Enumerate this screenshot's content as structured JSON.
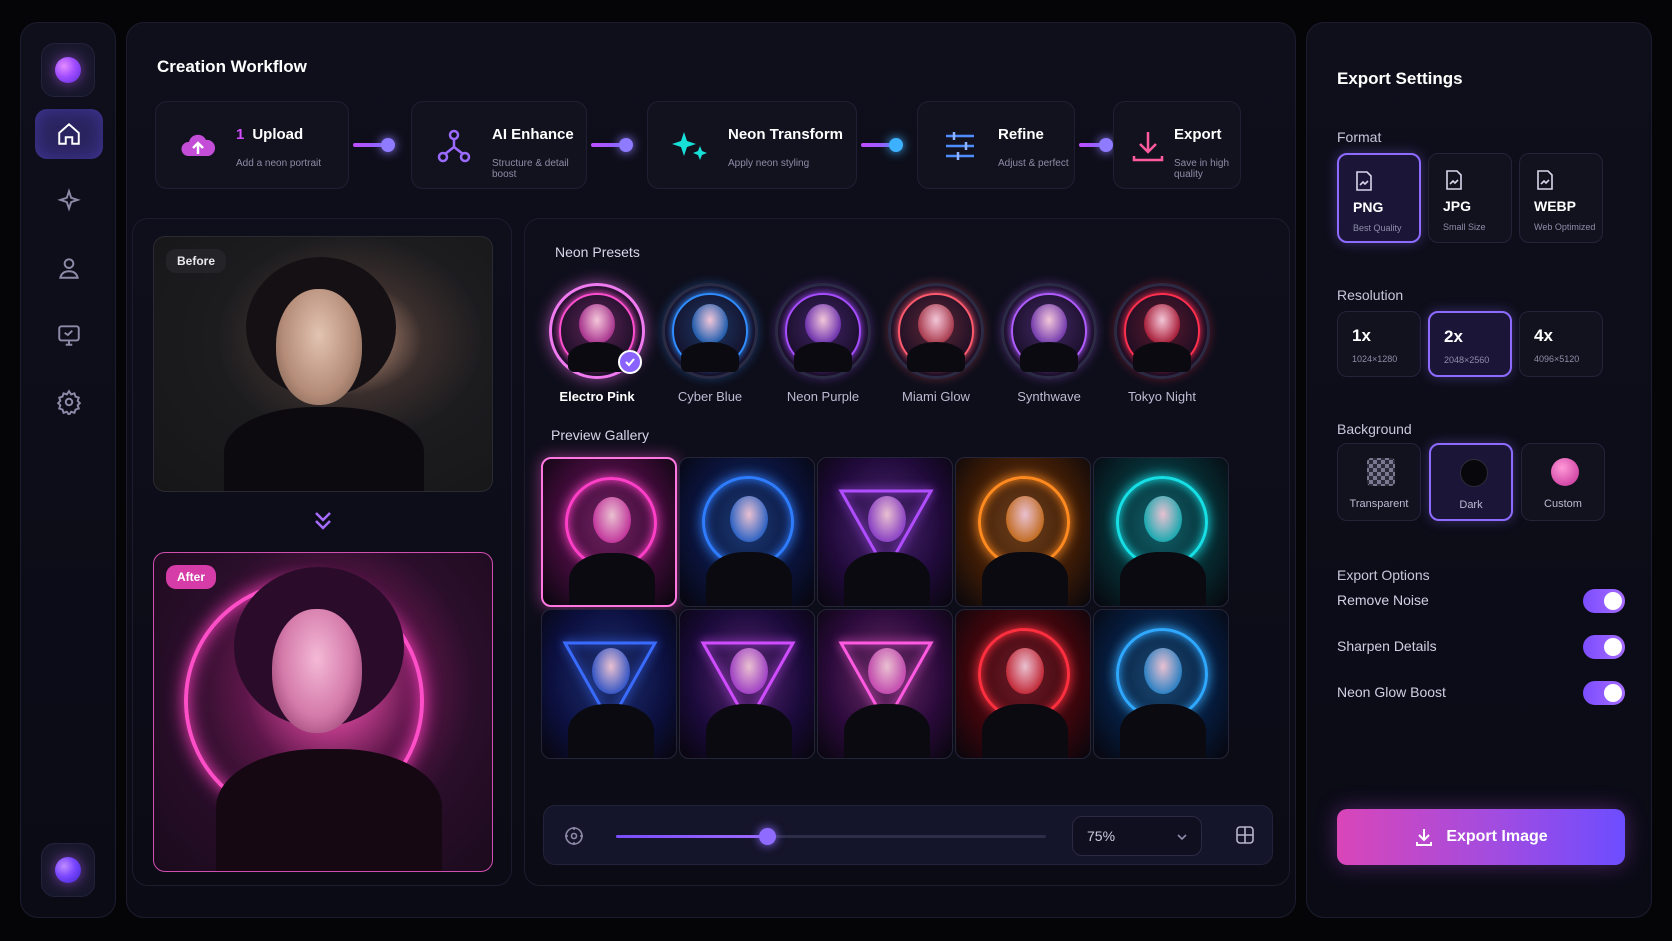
{
  "workflow": {
    "title": "Creation Workflow",
    "steps": [
      {
        "num": "1",
        "title": "Upload",
        "sub": "Add a neon portrait",
        "icon": "cloud-upload-icon"
      },
      {
        "num": "",
        "title": "AI Enhance",
        "sub": "Structure & detail boost",
        "icon": "nodes-icon"
      },
      {
        "num": "",
        "title": "Neon Transform",
        "sub": "Apply neon styling",
        "icon": "sparkles-icon"
      },
      {
        "num": "",
        "title": "Refine",
        "sub": "Adjust & perfect",
        "icon": "sliders-icon"
      },
      {
        "num": "",
        "title": "Export",
        "sub": "Save in high quality",
        "icon": "download-icon"
      }
    ]
  },
  "sidebar": {
    "items": [
      {
        "name": "home",
        "icon": "home-icon",
        "active": true
      },
      {
        "name": "magic",
        "icon": "sparkle-icon",
        "active": false
      },
      {
        "name": "profile",
        "icon": "user-icon",
        "active": false
      },
      {
        "name": "display",
        "icon": "monitor-icon",
        "active": false
      },
      {
        "name": "settings",
        "icon": "gear-icon",
        "active": false
      }
    ]
  },
  "compare": {
    "before_label": "Before",
    "after_label": "After"
  },
  "presets": {
    "title": "Neon Presets",
    "items": [
      {
        "label": "Electro Pink",
        "color": "#ff4fd0",
        "selected": true
      },
      {
        "label": "Cyber Blue",
        "color": "#2f8dff",
        "selected": false
      },
      {
        "label": "Neon Purple",
        "color": "#a64dff",
        "selected": false
      },
      {
        "label": "Miami Glow",
        "color": "#ff5a6e",
        "selected": false
      },
      {
        "label": "Synthwave",
        "color": "#b05cff",
        "selected": false
      },
      {
        "label": "Tokyo Night",
        "color": "#ff2f4f",
        "selected": false
      }
    ]
  },
  "gallery": {
    "title": "Preview Gallery",
    "thumbs": [
      {
        "style": "ring",
        "color": "#ff3fc8",
        "bg": "#3a0a34",
        "selected": true
      },
      {
        "style": "ring",
        "color": "#2f7dff",
        "bg": "#0a1238",
        "selected": false
      },
      {
        "style": "triangle",
        "color": "#b04dff",
        "bg": "#200a3a",
        "selected": false
      },
      {
        "style": "ring",
        "color": "#ff8a1f",
        "bg": "#3a1a06",
        "selected": false
      },
      {
        "style": "ring",
        "color": "#16e0e6",
        "bg": "#06282e",
        "selected": false
      },
      {
        "style": "triangle",
        "color": "#3a6bff",
        "bg": "#0c1040",
        "selected": false
      },
      {
        "style": "triangle",
        "color": "#d04dff",
        "bg": "#1a0a3a",
        "selected": false
      },
      {
        "style": "triangle",
        "color": "#ff5ae0",
        "bg": "#2a0a3a",
        "selected": false
      },
      {
        "style": "ring",
        "color": "#ff2f3f",
        "bg": "#3a060c",
        "selected": false
      },
      {
        "style": "ring",
        "color": "#2fa8ff",
        "bg": "#061a3a",
        "selected": false
      }
    ]
  },
  "zoom": {
    "value": "75%",
    "slider_fraction": 0.35
  },
  "export": {
    "title": "Export Settings",
    "format_label": "Format",
    "formats": [
      {
        "main": "PNG",
        "sub": "Best Quality",
        "selected": true
      },
      {
        "main": "JPG",
        "sub": "Small Size",
        "selected": false
      },
      {
        "main": "WEBP",
        "sub": "Web Optimized",
        "selected": false
      }
    ],
    "resolution_label": "Resolution",
    "resolutions": [
      {
        "main": "1x",
        "sub": "1024×1280",
        "selected": false
      },
      {
        "main": "2x",
        "sub": "2048×2560",
        "selected": true
      },
      {
        "main": "4x",
        "sub": "4096×5120",
        "selected": false
      }
    ],
    "background_label": "Background",
    "backgrounds": [
      {
        "label": "Transparent",
        "selected": false
      },
      {
        "label": "Dark",
        "selected": true
      },
      {
        "label": "Custom",
        "selected": false
      }
    ],
    "options_label": "Export Options",
    "options": [
      {
        "label": "Remove Noise",
        "on": true
      },
      {
        "label": "Sharpen Details",
        "on": true
      },
      {
        "label": "Neon Glow Boost",
        "on": true
      }
    ],
    "button_label": "Export Image"
  }
}
